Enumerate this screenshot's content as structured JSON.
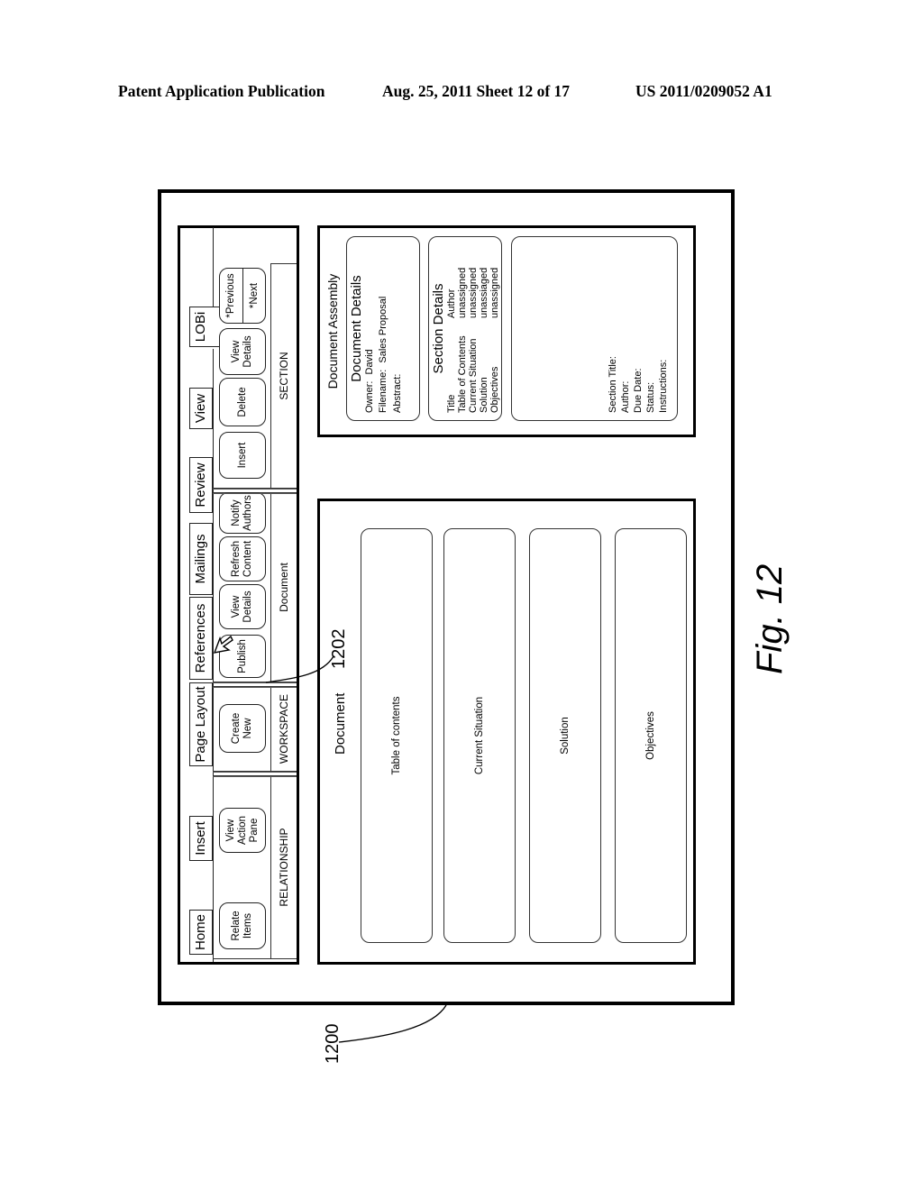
{
  "header": {
    "publication": "Patent Application Publication",
    "date_sheet": "Aug. 25, 2011   Sheet 12 of 17",
    "number": "US 2011/0209052 A1"
  },
  "ribbon": {
    "tabs": [
      "Home",
      "Insert",
      "Page Layout",
      "References",
      "Mailings",
      "Review",
      "View",
      "LOBi"
    ],
    "groups": [
      {
        "label": "RELATIONSHIP",
        "buttons": [
          "Relate\nItems",
          "View\nAction\nPane"
        ]
      },
      {
        "label": "WORKSPACE",
        "buttons": [
          "Create\nNew"
        ]
      },
      {
        "label": "Document",
        "buttons": [
          "Publish",
          "View\nDetails",
          "Refresh\nContent",
          "Notify\nAuthors"
        ]
      },
      {
        "label": "SECTION",
        "buttons": [
          "Insert",
          "Delete",
          "View\nDetails"
        ],
        "nav": {
          "previous": "*Previous",
          "next": "*Next"
        }
      }
    ]
  },
  "document_panel": {
    "title": "Document",
    "sections": [
      "Table of contents",
      "Current Situation",
      "Solution",
      "Objectives"
    ]
  },
  "assembly_panel": {
    "title": "Document Assembly",
    "document_details": {
      "heading": "Document Details",
      "owner_label": "Owner:",
      "owner_value": "David",
      "filename_label": "Filename:",
      "filename_value": "Sales Proposal",
      "abstract_label": "Abstract:"
    },
    "section_details": {
      "heading": "Section Details",
      "col_title": "Title",
      "col_author": "Author",
      "rows": [
        {
          "title": "Table of Contents",
          "author": "unassigned"
        },
        {
          "title": "Current Situation",
          "author": "unassigned"
        },
        {
          "title": "Solution",
          "author": "unassiaged"
        },
        {
          "title": "Objectives",
          "author": "unassigned"
        }
      ]
    },
    "section_info": [
      "Section Title:",
      "Author:",
      "Due Date:",
      "Status:",
      "Instructions:"
    ]
  },
  "callouts": {
    "ref_ui": "1200",
    "ref_publish": "1202",
    "figure": "Fig. 12"
  }
}
